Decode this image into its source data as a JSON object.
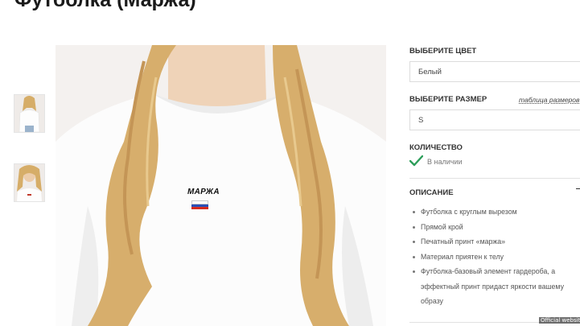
{
  "product": {
    "title": "Футболка (Маржа)",
    "print_text": "МАРЖА"
  },
  "options": {
    "color": {
      "label": "ВЫБЕРИТЕ ЦВЕТ",
      "value": "Белый"
    },
    "size": {
      "label": "ВЫБЕРИТЕ РАЗМЕР",
      "value": "S",
      "table_link": "таблица размеров"
    },
    "quantity": {
      "label": "КОЛИЧЕСТВО",
      "stock": "В наличии",
      "stock_icon": "check-icon"
    }
  },
  "description": {
    "label": "ОПИСАНИЕ",
    "toggle_icon": "minus-icon",
    "items": [
      "Футболка с круглым вырезом",
      "Прямой крой",
      "Печатный принт «маржа»",
      "Материал приятен к телу",
      "Футболка-базовый элемент гардероба, а эффектный принт придаст яркости вашему образу"
    ]
  },
  "colors": {
    "check": "#2e9e5b",
    "flag_white": "#ffffff",
    "flag_blue": "#2a4fb5",
    "flag_red": "#d52b1e",
    "hair": "#d8b06a"
  },
  "watermark": "Official website"
}
